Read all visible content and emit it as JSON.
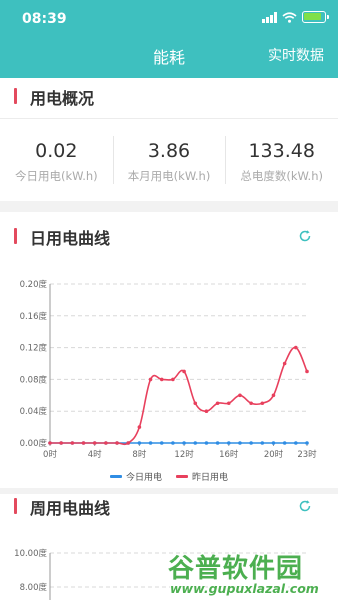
{
  "status_bar": {
    "time": "08:39"
  },
  "nav": {
    "title": "能耗",
    "action": "实时数据"
  },
  "overview": {
    "title": "用电概况",
    "stats": [
      {
        "value": "0.02",
        "label": "今日用电(kW.h)"
      },
      {
        "value": "3.86",
        "label": "本月用电(kW.h)"
      },
      {
        "value": "133.48",
        "label": "总电度数(kW.h)"
      }
    ]
  },
  "daily": {
    "title": "日用电曲线",
    "refresh_icon": "refresh-icon"
  },
  "weekly": {
    "title": "周用电曲线",
    "refresh_icon": "refresh-icon"
  },
  "watermark": {
    "main": "谷普软件园",
    "sub": "www.gupuxlazal.com"
  },
  "colors": {
    "accent": "#3ec0bf",
    "today": "#2f8de4",
    "yesterday": "#e8405d",
    "section_bar": "#e34a5e"
  },
  "chart_data": [
    {
      "type": "line",
      "title": "日用电曲线",
      "x": [
        0,
        1,
        2,
        3,
        4,
        5,
        6,
        7,
        8,
        9,
        10,
        11,
        12,
        13,
        14,
        15,
        16,
        17,
        18,
        19,
        20,
        21,
        22,
        23
      ],
      "x_tick_labels": [
        "0时",
        "4时",
        "8时",
        "12时",
        "16时",
        "20时",
        "23时"
      ],
      "y_tick_labels": [
        "0.20度",
        "0.16度",
        "0.12度",
        "0.08度",
        "0.04度",
        "0.00度"
      ],
      "ylim": [
        0,
        0.2
      ],
      "grid": true,
      "legend_position": "bottom",
      "series": [
        {
          "name": "今日用电",
          "color": "#2f8de4",
          "values": [
            0,
            0,
            0,
            0,
            0,
            0,
            0,
            0,
            0,
            0,
            0,
            0,
            0,
            0,
            0,
            0,
            0,
            0,
            0,
            0,
            0,
            0,
            0,
            0
          ]
        },
        {
          "name": "昨日用电",
          "color": "#e8405d",
          "values": [
            0,
            0,
            0,
            0,
            0,
            0,
            0,
            0,
            0.02,
            0.08,
            0.08,
            0.08,
            0.09,
            0.05,
            0.04,
            0.05,
            0.05,
            0.06,
            0.05,
            0.05,
            0.06,
            0.1,
            0.12,
            0.09
          ]
        }
      ]
    },
    {
      "type": "line",
      "title": "周用电曲线",
      "y_tick_labels": [
        "10.00度",
        "8.00度"
      ],
      "ylim": [
        8,
        10
      ],
      "series": []
    }
  ]
}
